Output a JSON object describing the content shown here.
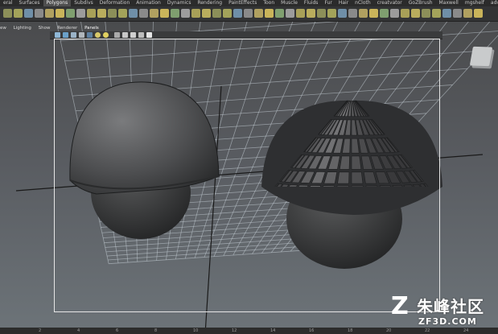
{
  "shelf": {
    "tabs": [
      "eral",
      "Surfaces",
      "Polygons",
      "Subdivs",
      "Deformation",
      "Animation",
      "Dynamics",
      "Rendering",
      "PaintEffects",
      "Toon",
      "Muscle",
      "Fluids",
      "Fur",
      "Hair",
      "nCloth",
      "creatvator",
      "GoZBrush",
      "Maxwell",
      "mgshelf",
      "advance"
    ],
    "active_tab": "Polygons",
    "icon_colors": [
      "#8c8f59",
      "#a3a35a",
      "#6f8fa8",
      "#8a8a8a",
      "#b0a060",
      "#c9b45a",
      "#7f9f6f",
      "#9c9c9c",
      "#a8a058",
      "#b9ad5d"
    ]
  },
  "panel_menu": {
    "items": [
      "ew",
      "Lighting",
      "Show",
      "Renderer",
      "Panels"
    ]
  },
  "viewport": {
    "background_top": "#4a4b4d",
    "background_bottom": "#6d7479",
    "frame_color": "#e6e6e6",
    "grid_color": "#c9d2d8"
  },
  "timeline": {
    "ticks": [
      "",
      "2",
      "4",
      "6",
      "8",
      "10",
      "12",
      "14",
      "16",
      "18",
      "20",
      "22",
      "24"
    ]
  },
  "watermark": {
    "chinese": "朱峰社区",
    "url": "ZF3D.COM"
  }
}
